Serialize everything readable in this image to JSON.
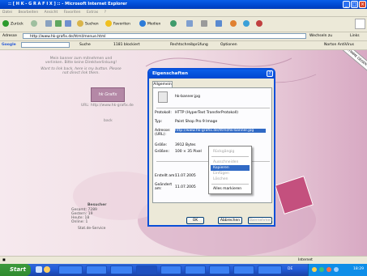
{
  "window": {
    "title": ":: [ H K - G R A F I X ] :: - Microsoft Internet Explorer"
  },
  "menubar": [
    "Datei",
    "Bearbeiten",
    "Ansicht",
    "Favoriten",
    "Extras",
    "?"
  ],
  "toolbar": {
    "back": "Zurück",
    "search": "Suchen",
    "favorites": "Favoriten",
    "media": "Medien"
  },
  "address": {
    "label": "Adresse",
    "url": "http://www.hk-grafix.de/html/menue.html",
    "go": "Wechseln zu",
    "links": "Links"
  },
  "googlebar": {
    "label": "Google",
    "search": "Suche",
    "blocked": "1181 blockiert",
    "spell": "Rechtschreibprüfung",
    "options": "Optionen",
    "norton": "Norton AntiVirus"
  },
  "page": {
    "intro_1": "Mein banner zum mitnehmen und",
    "intro_2": "verlinken. Bitte keine Direktverlinkung!",
    "intro_3": "Want to link back, here is my button. Please",
    "intro_4": "not direct link them.",
    "logo": "hk Grafix",
    "url_line": "URL: http://www.hk-grafix.de",
    "back_link": "back",
    "stats_title": "Besucher",
    "stats": [
      {
        "label": "Gesamt:",
        "value": "7289"
      },
      {
        "label": "Gestern:",
        "value": "19"
      },
      {
        "label": "Heute:",
        "value": "18"
      },
      {
        "label": "Online:",
        "value": "1"
      }
    ],
    "stats_link": "Stat.de-Service",
    "ribbon": "DEINE STIMME GEGEN ARMUT"
  },
  "dialog": {
    "title": "Eigenschaften",
    "tab": "Allgemein",
    "filename": "hk-banner.jpg",
    "rows": [
      {
        "label": "Protokoll:",
        "value": "HTTP (HyperText TransferProtokoll)"
      },
      {
        "label": "Typ:",
        "value": "Paint Shop Pro 9 Image"
      },
      {
        "label": "Adresse:\n(URL):",
        "value": "http://www.hk-grafix.de/html/hk-banner.jpg"
      },
      {
        "label": "Größe:",
        "value": "3912 Bytes"
      },
      {
        "label": "Größen:",
        "value": "100 × 35 Pixel"
      },
      {
        "label": "Erstellt am:",
        "value": "11.07.2005"
      },
      {
        "label": "Geändert am:",
        "value": "11.07.2005"
      }
    ],
    "buttons": {
      "ok": "OK",
      "cancel": "Abbrechen",
      "apply": "Übernehmen"
    }
  },
  "context_menu": {
    "items": [
      {
        "label": "Rückgängig",
        "state": "disabled"
      },
      {
        "label": "Ausschneiden",
        "state": "disabled"
      },
      {
        "label": "Kopieren",
        "state": "selected"
      },
      {
        "label": "Einfügen",
        "state": "disabled"
      },
      {
        "label": "Löschen",
        "state": "disabled"
      },
      {
        "label": "Alles markieren",
        "state": "enabled"
      }
    ]
  },
  "status": {
    "zone": "Internet"
  },
  "taskbar": {
    "start": "Start",
    "lang": "DE",
    "clock": "18:29"
  }
}
